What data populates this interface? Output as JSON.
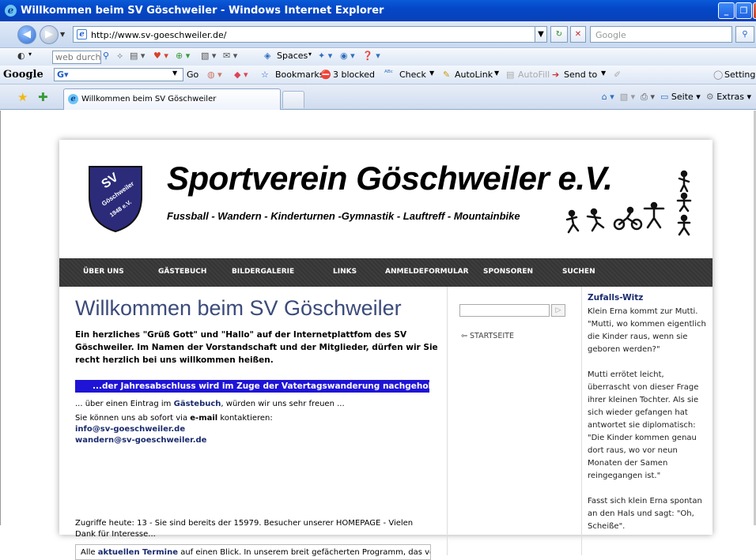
{
  "window": {
    "title": "Willkommen beim SV Göschweiler - Windows Internet Explorer",
    "url": "http://www.sv-goeschweiler.de/",
    "search_placeholder": "Google"
  },
  "toolbar1": {
    "websearch_placeholder": "web durchsuc",
    "spaces": "Spaces"
  },
  "toolbar2": {
    "google": "Google",
    "go": "Go",
    "bookmarks": "Bookmarks",
    "blocked": "3 blocked",
    "check": "Check",
    "autolink": "AutoLink",
    "autofill": "AutoFill",
    "sendto": "Send to",
    "settings": "Settings"
  },
  "tabs": [
    {
      "label": "Willkommen beim SV Göschweiler"
    }
  ],
  "commandbar": {
    "seite": "Seite",
    "extras": "Extras"
  },
  "site": {
    "title": "Sportverein Göschweiler e.V.",
    "subtitle": "Fussball - Wandern - Kinderturnen -Gymnastik - Lauftreff - Mountainbike",
    "seal_top": "SV",
    "seal_text": "Göschweiler",
    "seal_year": "1948 e.V.",
    "menu": [
      "ÜBER UNS",
      "GÄSTEBUCH",
      "BILDERGALERIE",
      "LINKS",
      "ANMELDEFORMULAR",
      "SPONSOREN",
      "SUCHEN"
    ],
    "heading": "Willkommen beim SV Göschweiler",
    "intro": "Ein herzliches \"Grüß Gott\" und \"Hallo\" auf der Internetplattfom des SV Göschweiler. Im Namen der Vorstandschaft und der Mitglieder, dürfen wir Sie recht herzlich bei uns willkommen heißen.",
    "marquee": "...der Jahresabschluss wird im Zuge der Vatertagswanderung nachgeholt - nähere",
    "guestbook_pre": "... über einen Eintrag im ",
    "guestbook_link": "Gästebuch",
    "guestbook_post": ", würden wir uns sehr freuen ...",
    "contact_pre": "Sie können uns ab sofort via ",
    "contact_bold": "e-mail",
    "contact_post": " kontaktieren:",
    "email1": "info@sv-goeschweiler.de",
    "email2": "wandern@sv-goeschweiler.de",
    "counter": "Zugriffe heute: 13 - Sie sind bereits der 15979. Besucher unserer HOMEPAGE - Vielen Dank für Interesse...",
    "termine_pre": "Alle ",
    "termine_bold": "aktuellen Termine",
    "termine_post": " auf einen Blick. In unserem breit gefächerten Programm, das von",
    "startseite": "STARTSEITE",
    "witz_title": "Zufalls-Witz",
    "witz_p1": "Klein Erna kommt zur Mutti. \"Mutti, wo kommen eigentlich die Kinder raus, wenn sie geboren werden?\"",
    "witz_p2": "Mutti errötet leicht, überrascht von dieser Frage ihrer kleinen Tochter. Als sie sich wieder gefangen hat antwortet sie diplomatisch: \"Die Kinder kommen genau dort raus, wo vor neun Monaten der Samen reingegangen ist.\"",
    "witz_p3": "Fasst sich klein Erna spontan an den Hals und sagt: \"Oh, Scheiße\"."
  },
  "colors": {
    "titlebar": "#0447c8",
    "menu_bg": "#3d3d3d",
    "heading": "#3b4b7a",
    "marquee_bg": "#1f14d6",
    "link": "#1a2b6e"
  }
}
